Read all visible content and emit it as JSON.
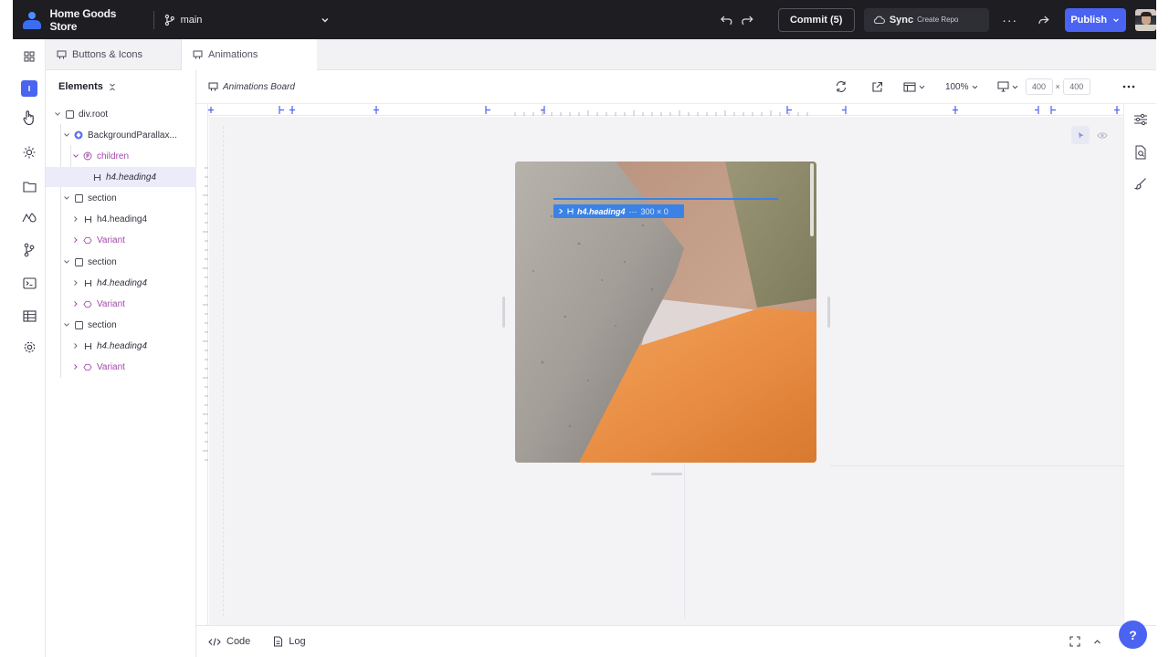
{
  "topbar": {
    "store_name": "Home Goods Store",
    "branch": "main",
    "commit_label": "Commit (5)",
    "sync_label": "Sync",
    "sync_sub": "Create Repo",
    "more": "···",
    "publish_label": "Publish"
  },
  "tabs": [
    {
      "label": "Buttons & Icons"
    },
    {
      "label": "Animations"
    }
  ],
  "panel": {
    "title": "Elements",
    "tree": [
      {
        "label": "div.root",
        "italic": false
      },
      {
        "label": "BackgroundParallax...",
        "italic": false
      },
      {
        "label": "children",
        "italic": false
      },
      {
        "label": "h4.heading4",
        "italic": true
      },
      {
        "label": "section",
        "italic": false
      },
      {
        "label": "h4.heading4",
        "italic": false
      },
      {
        "label": "Variant",
        "italic": false
      },
      {
        "label": "section",
        "italic": false
      },
      {
        "label": "h4.heading4",
        "italic": false
      },
      {
        "label": "Variant",
        "italic": false
      },
      {
        "label": "section",
        "italic": false
      },
      {
        "label": "h4.heading4",
        "italic": false
      },
      {
        "label": "Variant",
        "italic": false
      }
    ]
  },
  "canvas_toolbar": {
    "board_name": "Animations Board",
    "zoom": "100%",
    "width": "400",
    "height": "400",
    "times": "×"
  },
  "selection": {
    "element": "h4.heading4",
    "size": "300 × 0",
    "dots": "···"
  },
  "bottombar": {
    "code_label": "Code",
    "log_label": "Log"
  },
  "help": "?",
  "colors": {
    "accent": "#4a63f1",
    "selection": "#3b82e6",
    "topbar": "#1d1d22",
    "purple": "#a24aa8"
  }
}
